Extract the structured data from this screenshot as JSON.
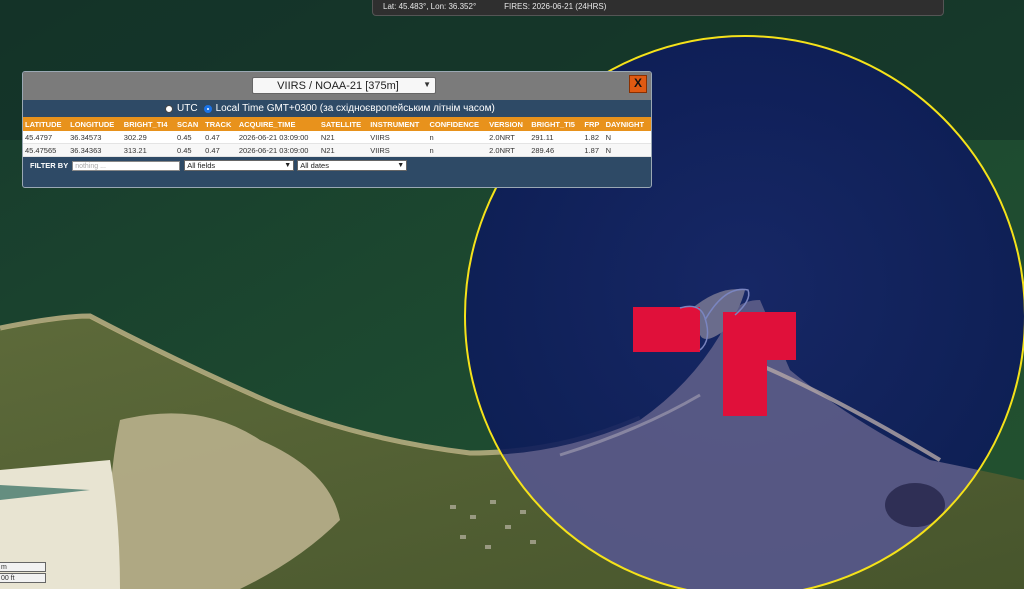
{
  "status_bar": {
    "coords": "Lat: 45.483°, Lon: 36.352°",
    "fires": "FIRES: 2026-06-21 (24HRS)"
  },
  "scale_bar": {
    "labels": [
      "m",
      "00 ft"
    ]
  },
  "popup": {
    "satellite_selected": "VIIRS / NOAA-21 [375m]",
    "close_label": "X",
    "tz_utc_label": "UTC",
    "tz_local_label": "Local Time GMT+0300 (за східноєвропейським літнім часом)",
    "tz_selected": "local",
    "table": {
      "columns": [
        "LATITUDE",
        "LONGITUDE",
        "BRIGHT_TI4",
        "SCAN",
        "TRACK",
        "ACQUIRE_TIME",
        "SATELLITE",
        "INSTRUMENT",
        "CONFIDENCE",
        "VERSION",
        "BRIGHT_TI5",
        "FRP",
        "DAYNIGHT"
      ],
      "rows": [
        [
          "45.4797",
          "36.34573",
          "302.29",
          "0.45",
          "0.47",
          "2026-06-21 03:09:00",
          "N21",
          "VIIRS",
          "n",
          "2.0NRT",
          "291.11",
          "1.82",
          "N"
        ],
        [
          "45.47565",
          "36.34363",
          "313.21",
          "0.45",
          "0.47",
          "2026-06-21 03:09:00",
          "N21",
          "VIIRS",
          "n",
          "2.0NRT",
          "289.46",
          "1.87",
          "N"
        ]
      ]
    },
    "filter": {
      "label": "FILTER BY",
      "placeholder": "nothing ...",
      "field_selected": "All fields",
      "date_selected": "All dates"
    }
  },
  "colors": {
    "fire_marker": "#e0103a",
    "radius_circle": "#f5e21a",
    "table_header": "#e8921c",
    "close_button": "#e05a12"
  },
  "icons": {
    "close": "close-icon",
    "dropdown": "chevron-down-icon"
  }
}
